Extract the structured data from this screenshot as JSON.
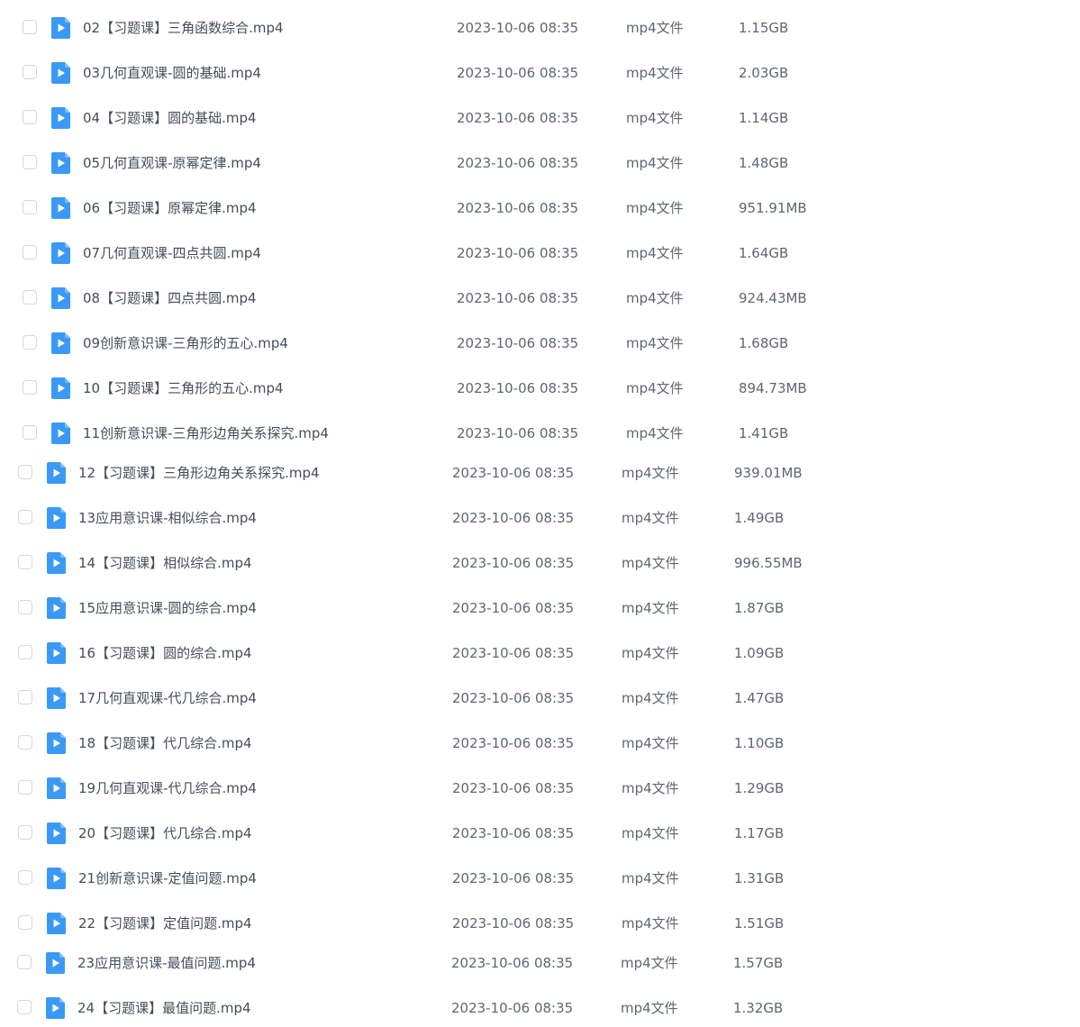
{
  "colors": {
    "file_icon": "#3a99f5",
    "checkbox_border": "#d4d7de",
    "text": "#454d5a"
  },
  "icons": {
    "file": "video-file-icon",
    "select": "checkbox"
  },
  "files": [
    {
      "name": "02【习题课】三角函数综合.mp4",
      "date": "2023-10-06 08:35",
      "type": "mp4文件",
      "size": "1.15GB"
    },
    {
      "name": "03几何直观课-圆的基础.mp4",
      "date": "2023-10-06 08:35",
      "type": "mp4文件",
      "size": "2.03GB"
    },
    {
      "name": "04【习题课】圆的基础.mp4",
      "date": "2023-10-06 08:35",
      "type": "mp4文件",
      "size": "1.14GB"
    },
    {
      "name": "05几何直观课-原幂定律.mp4",
      "date": "2023-10-06 08:35",
      "type": "mp4文件",
      "size": "1.48GB"
    },
    {
      "name": "06【习题课】原幂定律.mp4",
      "date": "2023-10-06 08:35",
      "type": "mp4文件",
      "size": "951.91MB"
    },
    {
      "name": "07几何直观课-四点共圆.mp4",
      "date": "2023-10-06 08:35",
      "type": "mp4文件",
      "size": "1.64GB"
    },
    {
      "name": "08【习题课】四点共圆.mp4",
      "date": "2023-10-06 08:35",
      "type": "mp4文件",
      "size": "924.43MB"
    },
    {
      "name": "09创新意识课-三角形的五心.mp4",
      "date": "2023-10-06 08:35",
      "type": "mp4文件",
      "size": "1.68GB"
    },
    {
      "name": "10【习题课】三角形的五心.mp4",
      "date": "2023-10-06 08:35",
      "type": "mp4文件",
      "size": "894.73MB"
    },
    {
      "name": "11创新意识课-三角形边角关系探究.mp4",
      "date": "2023-10-06 08:35",
      "type": "mp4文件",
      "size": "1.41GB"
    },
    {
      "name": "12【习题课】三角形边角关系探究.mp4",
      "date": "2023-10-06 08:35",
      "type": "mp4文件",
      "size": "939.01MB"
    },
    {
      "name": "13应用意识课-相似综合.mp4",
      "date": "2023-10-06 08:35",
      "type": "mp4文件",
      "size": "1.49GB"
    },
    {
      "name": "14【习题课】相似综合.mp4",
      "date": "2023-10-06 08:35",
      "type": "mp4文件",
      "size": "996.55MB"
    },
    {
      "name": "15应用意识课-圆的综合.mp4",
      "date": "2023-10-06 08:35",
      "type": "mp4文件",
      "size": "1.87GB"
    },
    {
      "name": "16【习题课】圆的综合.mp4",
      "date": "2023-10-06 08:35",
      "type": "mp4文件",
      "size": "1.09GB"
    },
    {
      "name": "17几何直观课-代几综合.mp4",
      "date": "2023-10-06 08:35",
      "type": "mp4文件",
      "size": "1.47GB"
    },
    {
      "name": "18【习题课】代几综合.mp4",
      "date": "2023-10-06 08:35",
      "type": "mp4文件",
      "size": "1.10GB"
    },
    {
      "name": "19几何直观课-代几综合.mp4",
      "date": "2023-10-06 08:35",
      "type": "mp4文件",
      "size": "1.29GB"
    },
    {
      "name": "20【习题课】代几综合.mp4",
      "date": "2023-10-06 08:35",
      "type": "mp4文件",
      "size": "1.17GB"
    },
    {
      "name": "21创新意识课-定值问题.mp4",
      "date": "2023-10-06 08:35",
      "type": "mp4文件",
      "size": "1.31GB"
    },
    {
      "name": "22【习题课】定值问题.mp4",
      "date": "2023-10-06 08:35",
      "type": "mp4文件",
      "size": "1.51GB"
    },
    {
      "name": "23应用意识课-最值问题.mp4",
      "date": "2023-10-06 08:35",
      "type": "mp4文件",
      "size": "1.57GB"
    },
    {
      "name": "24【习题课】最值问题.mp4",
      "date": "2023-10-06 08:35",
      "type": "mp4文件",
      "size": "1.32GB"
    }
  ]
}
